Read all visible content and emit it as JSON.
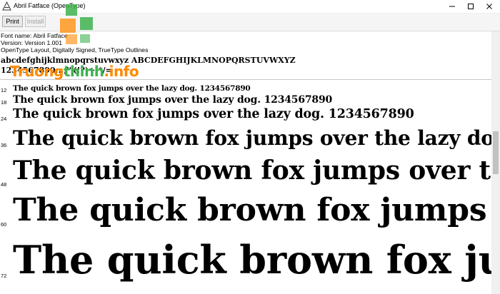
{
  "window": {
    "title": "Abril Fatface (OpenType)",
    "minimize_icon": "minimize-icon",
    "maximize_icon": "maximize-icon",
    "close_icon": "close-icon"
  },
  "toolbar": {
    "print_label": "Print",
    "install_label": "Install"
  },
  "font_info": {
    "name_line": "Font name: Abril Fatface",
    "version_line": "Version: Version 1.001",
    "features_line": "OpenType Layout, Digitally Signed, TrueType Outlines"
  },
  "character_set": {
    "lowercase": "abcdefghijklmnopqrstuvwxyz",
    "uppercase": "ABCDEFGHIJKLMNOPQRSTUVWXYZ",
    "digits_punct": "1234567890.:,;'\"(!?)+-*/="
  },
  "samples": {
    "pangram": "The quick brown fox jumps over the lazy dog. 1234567890",
    "sizes": [
      "12",
      "18",
      "24",
      "36",
      "48",
      "60",
      "72"
    ]
  },
  "watermark": {
    "part1": "Truong",
    "part2": "thinh",
    "part3": ".info"
  },
  "colors": {
    "watermark_orange": "#ff8a00",
    "watermark_green": "#3fb24f"
  }
}
